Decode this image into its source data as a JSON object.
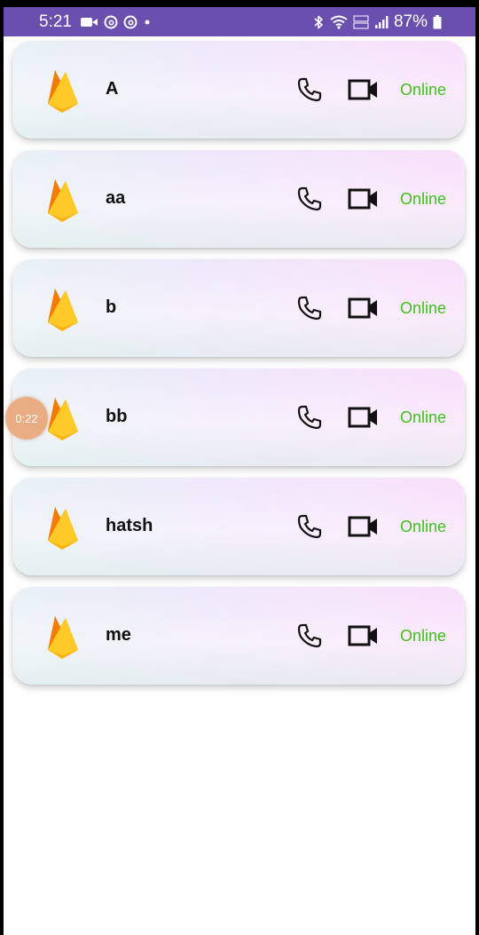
{
  "status_bar": {
    "time": "5:21",
    "battery": "87%",
    "left_icons": [
      "video-recording-icon",
      "threads-icon",
      "threads-icon",
      "dot-icon"
    ],
    "right_icons": [
      "bluetooth-icon",
      "wifi-icon",
      "volte-icon",
      "signal-icon",
      "battery-icon"
    ],
    "background": "#6a4fae"
  },
  "users": [
    {
      "name": "A",
      "status": "Online"
    },
    {
      "name": "aa",
      "status": "Online"
    },
    {
      "name": "b",
      "status": "Online"
    },
    {
      "name": "bb",
      "status": "Online"
    },
    {
      "name": "hatsh",
      "status": "Online"
    },
    {
      "name": "me",
      "status": "Online"
    }
  ],
  "recording_timer": "0:22",
  "colors": {
    "online": "#3fbf1d",
    "logo_flame": "#ffca28",
    "logo_flame_dark": "#f6a623"
  }
}
